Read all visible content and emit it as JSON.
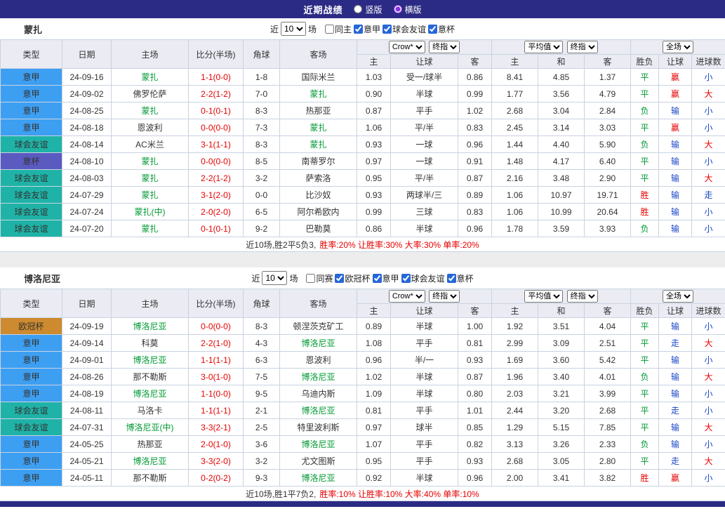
{
  "page": {
    "title": "近期战绩",
    "views": [
      {
        "name": "vertical",
        "label": "竖版",
        "selected": false
      },
      {
        "name": "horizontal",
        "label": "横版",
        "selected": true
      }
    ]
  },
  "labels": {
    "near": "近",
    "games": "场"
  },
  "colors": {
    "topbar": "#2b2b85",
    "focus_team": "#009933",
    "score": "#e60000",
    "type": {
      "意甲": "#3d9ff2",
      "球会友谊": "#1fb3a7",
      "意杯": "#5a5ac0",
      "欧冠杯": "#cd8a2e"
    },
    "result": {
      "胜": "#e60000",
      "平": "#009933",
      "负": "#009933",
      "赢": "#e60000",
      "输": "#1846c8",
      "走": "#1846c8",
      "大": "#e60000",
      "小": "#1846c8"
    }
  },
  "table_header": {
    "type": "类型",
    "date": "日期",
    "home": "主场",
    "score": "比分(半场)",
    "corner": "角球",
    "away": "客场",
    "dd_crown": "Crow*",
    "dd_final": "终指",
    "dd_avg": "平均值",
    "dd_full": "全场",
    "odds_home": "主",
    "odds_handicap": "让球",
    "odds_away": "客",
    "avg_home": "主",
    "avg_draw": "和",
    "avg_away": "客",
    "res_outcome": "胜负",
    "res_handicap": "让球",
    "res_goals": "进球数"
  },
  "sections": [
    {
      "team": "蒙扎",
      "filter": {
        "count": "10",
        "checks": [
          {
            "name": "same-home",
            "label": "同主",
            "checked": false
          },
          {
            "name": "serie-a",
            "label": "意甲",
            "checked": true
          },
          {
            "name": "club-friendly",
            "label": "球会友谊",
            "checked": true
          },
          {
            "name": "italy-cup",
            "label": "意杯",
            "checked": true
          }
        ]
      },
      "rows": [
        {
          "type": "意甲",
          "date": "24-09-16",
          "home": "蒙扎",
          "score": "1-1(0-0)",
          "corner": "1-8",
          "away": "国际米兰",
          "odds_home": "1.03",
          "handicap": "受一/球半",
          "odds_away": "0.86",
          "avg_home": "8.41",
          "avg_draw": "4.85",
          "avg_away": "1.37",
          "result": "平",
          "handicap_result": "赢",
          "goals": "小"
        },
        {
          "type": "意甲",
          "date": "24-09-02",
          "home": "佛罗伦萨",
          "score": "2-2(1-2)",
          "corner": "7-0",
          "away": "蒙扎",
          "odds_home": "0.90",
          "handicap": "半球",
          "odds_away": "0.99",
          "avg_home": "1.77",
          "avg_draw": "3.56",
          "avg_away": "4.79",
          "result": "平",
          "handicap_result": "赢",
          "goals": "大"
        },
        {
          "type": "意甲",
          "date": "24-08-25",
          "home": "蒙扎",
          "score": "0-1(0-1)",
          "corner": "8-3",
          "away": "热那亚",
          "odds_home": "0.87",
          "handicap": "平手",
          "odds_away": "1.02",
          "avg_home": "2.68",
          "avg_draw": "3.04",
          "avg_away": "2.84",
          "result": "负",
          "handicap_result": "输",
          "goals": "小"
        },
        {
          "type": "意甲",
          "date": "24-08-18",
          "home": "恩波利",
          "score": "0-0(0-0)",
          "corner": "7-3",
          "away": "蒙扎",
          "odds_home": "1.06",
          "handicap": "平/半",
          "odds_away": "0.83",
          "avg_home": "2.45",
          "avg_draw": "3.14",
          "avg_away": "3.03",
          "result": "平",
          "handicap_result": "赢",
          "goals": "小"
        },
        {
          "type": "球会友谊",
          "date": "24-08-14",
          "home": "AC米兰",
          "score": "3-1(1-1)",
          "corner": "8-3",
          "away": "蒙扎",
          "odds_home": "0.93",
          "handicap": "一球",
          "odds_away": "0.96",
          "avg_home": "1.44",
          "avg_draw": "4.40",
          "avg_away": "5.90",
          "result": "负",
          "handicap_result": "输",
          "goals": "大"
        },
        {
          "type": "意杯",
          "date": "24-08-10",
          "home": "蒙扎",
          "score": "0-0(0-0)",
          "corner": "8-5",
          "away": "南蒂罗尔",
          "odds_home": "0.97",
          "handicap": "一球",
          "odds_away": "0.91",
          "avg_home": "1.48",
          "avg_draw": "4.17",
          "avg_away": "6.40",
          "result": "平",
          "handicap_result": "输",
          "goals": "小"
        },
        {
          "type": "球会友谊",
          "date": "24-08-03",
          "home": "蒙扎",
          "score": "2-2(1-2)",
          "corner": "3-2",
          "away": "萨索洛",
          "odds_home": "0.95",
          "handicap": "平/半",
          "odds_away": "0.87",
          "avg_home": "2.16",
          "avg_draw": "3.48",
          "avg_away": "2.90",
          "result": "平",
          "handicap_result": "输",
          "goals": "大"
        },
        {
          "type": "球会友谊",
          "date": "24-07-29",
          "home": "蒙扎",
          "score": "3-1(2-0)",
          "corner": "0-0",
          "away": "比沙奴",
          "odds_home": "0.93",
          "handicap": "两球半/三",
          "odds_away": "0.89",
          "avg_home": "1.06",
          "avg_draw": "10.97",
          "avg_away": "19.71",
          "result": "胜",
          "handicap_result": "输",
          "goals": "走"
        },
        {
          "type": "球会友谊",
          "date": "24-07-24",
          "home": "蒙扎(中)",
          "score": "2-0(2-0)",
          "corner": "6-5",
          "away": "阿尔希欧内",
          "odds_home": "0.99",
          "handicap": "三球",
          "odds_away": "0.83",
          "avg_home": "1.06",
          "avg_draw": "10.99",
          "avg_away": "20.64",
          "result": "胜",
          "handicap_result": "输",
          "goals": "小"
        },
        {
          "type": "球会友谊",
          "date": "24-07-20",
          "home": "蒙扎",
          "score": "0-1(0-1)",
          "corner": "9-2",
          "away": "巴勒莫",
          "odds_home": "0.86",
          "handicap": "半球",
          "odds_away": "0.96",
          "avg_home": "1.78",
          "avg_draw": "3.59",
          "avg_away": "3.93",
          "result": "负",
          "handicap_result": "输",
          "goals": "小"
        }
      ],
      "summary": {
        "prefix": "近10场,胜2平5负3,",
        "rates": "胜率:20% 让胜率:30% 大率:30% 单率:20%"
      }
    },
    {
      "team": "博洛尼亚",
      "filter": {
        "count": "10",
        "checks": [
          {
            "name": "same-competition",
            "label": "同赛",
            "checked": false
          },
          {
            "name": "champions-league",
            "label": "欧冠杯",
            "checked": true
          },
          {
            "name": "serie-a",
            "label": "意甲",
            "checked": true
          },
          {
            "name": "club-friendly",
            "label": "球会友谊",
            "checked": true
          },
          {
            "name": "italy-cup",
            "label": "意杯",
            "checked": true
          }
        ]
      },
      "rows": [
        {
          "type": "欧冠杯",
          "date": "24-09-19",
          "home": "博洛尼亚",
          "score": "0-0(0-0)",
          "corner": "8-3",
          "away": "顿涅茨克矿工",
          "odds_home": "0.89",
          "handicap": "半球",
          "odds_away": "1.00",
          "avg_home": "1.92",
          "avg_draw": "3.51",
          "avg_away": "4.04",
          "result": "平",
          "handicap_result": "输",
          "goals": "小"
        },
        {
          "type": "意甲",
          "date": "24-09-14",
          "home": "科莫",
          "score": "2-2(1-0)",
          "corner": "4-3",
          "away": "博洛尼亚",
          "odds_home": "1.08",
          "handicap": "平手",
          "odds_away": "0.81",
          "avg_home": "2.99",
          "avg_draw": "3.09",
          "avg_away": "2.51",
          "result": "平",
          "handicap_result": "走",
          "goals": "大"
        },
        {
          "type": "意甲",
          "date": "24-09-01",
          "home": "博洛尼亚",
          "score": "1-1(1-1)",
          "corner": "6-3",
          "away": "恩波利",
          "odds_home": "0.96",
          "handicap": "半/一",
          "odds_away": "0.93",
          "avg_home": "1.69",
          "avg_draw": "3.60",
          "avg_away": "5.42",
          "result": "平",
          "handicap_result": "输",
          "goals": "小"
        },
        {
          "type": "意甲",
          "date": "24-08-26",
          "home": "那不勒斯",
          "score": "3-0(1-0)",
          "corner": "7-5",
          "away": "博洛尼亚",
          "odds_home": "1.02",
          "handicap": "半球",
          "odds_away": "0.87",
          "avg_home": "1.96",
          "avg_draw": "3.40",
          "avg_away": "4.01",
          "result": "负",
          "handicap_result": "输",
          "goals": "大"
        },
        {
          "type": "意甲",
          "date": "24-08-19",
          "home": "博洛尼亚",
          "score": "1-1(0-0)",
          "corner": "9-5",
          "away": "乌迪内斯",
          "odds_home": "1.09",
          "handicap": "半球",
          "odds_away": "0.80",
          "avg_home": "2.03",
          "avg_draw": "3.21",
          "avg_away": "3.99",
          "result": "平",
          "handicap_result": "输",
          "goals": "小"
        },
        {
          "type": "球会友谊",
          "date": "24-08-11",
          "home": "马洛卡",
          "score": "1-1(1-1)",
          "corner": "2-1",
          "away": "博洛尼亚",
          "odds_home": "0.81",
          "handicap": "平手",
          "odds_away": "1.01",
          "avg_home": "2.44",
          "avg_draw": "3.20",
          "avg_away": "2.68",
          "result": "平",
          "handicap_result": "走",
          "goals": "小"
        },
        {
          "type": "球会友谊",
          "date": "24-07-31",
          "home": "博洛尼亚(中)",
          "score": "3-3(2-1)",
          "corner": "2-5",
          "away": "特里波利斯",
          "odds_home": "0.97",
          "handicap": "球半",
          "odds_away": "0.85",
          "avg_home": "1.29",
          "avg_draw": "5.15",
          "avg_away": "7.85",
          "result": "平",
          "handicap_result": "输",
          "goals": "大"
        },
        {
          "type": "意甲",
          "date": "24-05-25",
          "home": "热那亚",
          "score": "2-0(1-0)",
          "corner": "3-6",
          "away": "博洛尼亚",
          "odds_home": "1.07",
          "handicap": "平手",
          "odds_away": "0.82",
          "avg_home": "3.13",
          "avg_draw": "3.26",
          "avg_away": "2.33",
          "result": "负",
          "handicap_result": "输",
          "goals": "小"
        },
        {
          "type": "意甲",
          "date": "24-05-21",
          "home": "博洛尼亚",
          "score": "3-3(2-0)",
          "corner": "3-2",
          "away": "尤文图斯",
          "odds_home": "0.95",
          "handicap": "平手",
          "odds_away": "0.93",
          "avg_home": "2.68",
          "avg_draw": "3.05",
          "avg_away": "2.80",
          "result": "平",
          "handicap_result": "走",
          "goals": "大"
        },
        {
          "type": "意甲",
          "date": "24-05-11",
          "home": "那不勒斯",
          "score": "0-2(0-2)",
          "corner": "9-3",
          "away": "博洛尼亚",
          "odds_home": "0.92",
          "handicap": "半球",
          "odds_away": "0.96",
          "avg_home": "2.00",
          "avg_draw": "3.41",
          "avg_away": "3.82",
          "result": "胜",
          "handicap_result": "赢",
          "goals": "小"
        }
      ],
      "summary": {
        "prefix": "近10场,胜1平7负2,",
        "rates": "胜率:10% 让胜率:10% 大率:40% 单率:10%"
      }
    }
  ]
}
